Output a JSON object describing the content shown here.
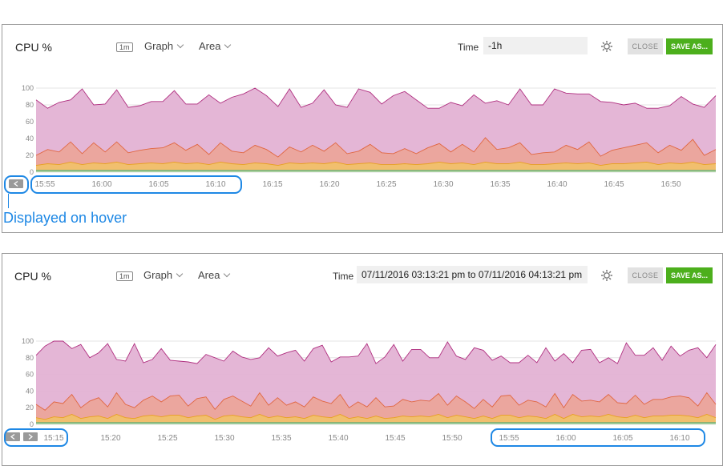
{
  "panels": [
    {
      "title": "CPU %",
      "interval_badge": "1m",
      "graph_dropdown": "Graph",
      "area_dropdown": "Area",
      "time_label": "Time",
      "time_value": "-1h",
      "close_label": "CLOSE",
      "save_label": "SAVE AS...",
      "settings_icon": "gear-icon",
      "nav_buttons": [
        "chevron-left-icon"
      ],
      "chart_data": {
        "type": "area",
        "ylim": [
          0,
          100
        ],
        "yticks": [
          "0",
          "20",
          "40",
          "60",
          "80",
          "100"
        ],
        "x_ticks": [
          "15:55",
          "16:00",
          "16:05",
          "16:10",
          "16:15",
          "16:20",
          "16:25",
          "16:30",
          "16:35",
          "16:40",
          "16:45",
          "16:50"
        ],
        "series": [
          {
            "color": "#e3b2d4",
            "line": "#b03080",
            "values": [
              86,
              76,
              83,
              86,
              99,
              80,
              81,
              98,
              77,
              79,
              84,
              84,
              97,
              81,
              81,
              92,
              82,
              89,
              93,
              100,
              91,
              78,
              99,
              77,
              82,
              98,
              80,
              77,
              99,
              95,
              81,
              91,
              96,
              86,
              76,
              76,
              83,
              79,
              92,
              82,
              85,
              80,
              99,
              80,
              80,
              99,
              94,
              93,
              93,
              84,
              83,
              80,
              82,
              76,
              76,
              79,
              90,
              81,
              77,
              91
            ]
          },
          {
            "color": "#eba59b",
            "line": "#e06640",
            "values": [
              20,
              27,
              24,
              36,
              22,
              35,
              24,
              36,
              23,
              26,
              28,
              29,
              35,
              26,
              33,
              21,
              35,
              25,
              23,
              32,
              27,
              18,
              30,
              24,
              32,
              25,
              35,
              22,
              25,
              33,
              23,
              22,
              28,
              22,
              29,
              34,
              24,
              33,
              24,
              41,
              27,
              29,
              35,
              21,
              23,
              24,
              32,
              27,
              36,
              19,
              26,
              29,
              32,
              35,
              23,
              32,
              26,
              39,
              20,
              27
            ]
          },
          {
            "color": "#f1c06c",
            "line": "#e8a020",
            "values": [
              8,
              10,
              9,
              12,
              9,
              11,
              10,
              12,
              9,
              10,
              11,
              10,
              12,
              10,
              11,
              9,
              12,
              10,
              9,
              11,
              10,
              8,
              11,
              10,
              11,
              10,
              12,
              9,
              10,
              11,
              9,
              9,
              10,
              9,
              10,
              12,
              10,
              11,
              9,
              12,
              10,
              10,
              12,
              9,
              9,
              10,
              11,
              10,
              11,
              8,
              10,
              10,
              11,
              12,
              9,
              11,
              10,
              12,
              9,
              10
            ]
          },
          {
            "color": "#b2d6a8",
            "line": "#30a070",
            "values": [
              2,
              2,
              2,
              2,
              2,
              2,
              2,
              2,
              2,
              2,
              2,
              2,
              2,
              2,
              2,
              2,
              2,
              2,
              2,
              2,
              2,
              2,
              2,
              2,
              2,
              2,
              2,
              2,
              2,
              2,
              2,
              2,
              2,
              2,
              2,
              2,
              2,
              2,
              2,
              2,
              2,
              2,
              2,
              2,
              2,
              2,
              2,
              2,
              2,
              2,
              2,
              2,
              2,
              2,
              2,
              2,
              2,
              2,
              2,
              2
            ]
          }
        ]
      }
    },
    {
      "title": "CPU %",
      "interval_badge": "1m",
      "graph_dropdown": "Graph",
      "area_dropdown": "Area",
      "time_label": "Time",
      "time_value": "07/11/2016 03:13:21 pm to 07/11/2016 04:13:21 pm",
      "close_label": "CLOSE",
      "save_label": "SAVE AS...",
      "settings_icon": "gear-icon",
      "nav_buttons": [
        "chevron-left-icon",
        "chevron-right-icon"
      ],
      "chart_data": {
        "type": "area",
        "ylim": [
          0,
          100
        ],
        "yticks": [
          "0",
          "20",
          "40",
          "60",
          "80",
          "100"
        ],
        "x_ticks": [
          "15:15",
          "15:20",
          "15:25",
          "15:30",
          "15:35",
          "15:40",
          "15:45",
          "15:50",
          "15:55",
          "16:00",
          "16:05",
          "16:10"
        ],
        "series": [
          {
            "color": "#e3b2d4",
            "line": "#b03080",
            "values": [
              83,
              94,
              100,
              100,
              91,
              96,
              80,
              86,
              97,
              78,
              76,
              97,
              74,
              78,
              91,
              77,
              76,
              75,
              73,
              84,
              80,
              76,
              88,
              81,
              78,
              80,
              92,
              82,
              86,
              89,
              76,
              91,
              95,
              75,
              81,
              81,
              82,
              97,
              73,
              81,
              96,
              76,
              90,
              90,
              80,
              80,
              99,
              82,
              78,
              92,
              89,
              77,
              82,
              74,
              74,
              83,
              74,
              92,
              76,
              85,
              74,
              89,
              90,
              74,
              80,
              73,
              98,
              83,
              83,
              92,
              77,
              94,
              82,
              89,
              92,
              80,
              96
            ]
          },
          {
            "color": "#eba59b",
            "line": "#e06640",
            "values": [
              24,
              17,
              27,
              25,
              36,
              20,
              28,
              32,
              21,
              38,
              24,
              20,
              29,
              34,
              27,
              34,
              35,
              22,
              31,
              33,
              18,
              30,
              34,
              28,
              22,
              38,
              23,
              32,
              23,
              27,
              21,
              33,
              28,
              25,
              36,
              20,
              27,
              21,
              32,
              21,
              22,
              30,
              27,
              29,
              28,
              37,
              23,
              34,
              27,
              19,
              30,
              21,
              34,
              35,
              23,
              29,
              27,
              21,
              37,
              20,
              36,
              28,
              29,
              27,
              36,
              26,
              25,
              35,
              24,
              30,
              30,
              33,
              34,
              32,
              22,
              38,
              24
            ]
          },
          {
            "color": "#f1c06c",
            "line": "#e8a020",
            "values": [
              8,
              6,
              9,
              8,
              12,
              7,
              9,
              10,
              7,
              12,
              8,
              7,
              10,
              11,
              9,
              11,
              11,
              8,
              10,
              11,
              6,
              10,
              11,
              9,
              8,
              12,
              8,
              10,
              8,
              9,
              7,
              11,
              9,
              8,
              12,
              7,
              9,
              7,
              10,
              7,
              8,
              10,
              9,
              10,
              9,
              12,
              8,
              11,
              9,
              7,
              10,
              7,
              11,
              11,
              8,
              10,
              9,
              7,
              12,
              7,
              12,
              9,
              10,
              9,
              12,
              9,
              8,
              11,
              8,
              10,
              10,
              11,
              11,
              10,
              8,
              12,
              8
            ]
          },
          {
            "color": "#b2d6a8",
            "line": "#30a070",
            "values": [
              2,
              2,
              2,
              2,
              2,
              2,
              2,
              2,
              2,
              2,
              2,
              2,
              2,
              2,
              2,
              2,
              2,
              2,
              2,
              2,
              2,
              2,
              2,
              2,
              2,
              2,
              2,
              2,
              2,
              2,
              2,
              2,
              2,
              2,
              2,
              2,
              2,
              2,
              2,
              2,
              2,
              2,
              2,
              2,
              2,
              2,
              2,
              2,
              2,
              2,
              2,
              2,
              2,
              2,
              2,
              2,
              2,
              2,
              2,
              2,
              2,
              2,
              2,
              2,
              2,
              2,
              2,
              2,
              2,
              2,
              2,
              2,
              2,
              2,
              2,
              2,
              2
            ]
          }
        ]
      }
    }
  ],
  "annotation": {
    "hover_text": "Displayed on hover",
    "color": "#1e88e5"
  }
}
